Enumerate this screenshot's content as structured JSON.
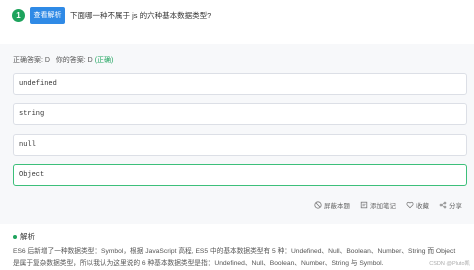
{
  "question": {
    "number": "1",
    "analysis_button": "查看解析",
    "text": "下面哪一种不属于 js 的六种基本数据类型?"
  },
  "answer": {
    "correct_label": "正确答案: D",
    "your_label": "你的答案: D",
    "status": "(正确)"
  },
  "options": [
    {
      "text": "undefined",
      "selected": false
    },
    {
      "text": "string",
      "selected": false
    },
    {
      "text": "null",
      "selected": false
    },
    {
      "text": "Object",
      "selected": true
    }
  ],
  "actions": {
    "hide": "屏蔽本题",
    "note": "添加笔记",
    "favorite": "收藏",
    "share": "分享"
  },
  "analysis": {
    "title": "解析",
    "line1": "ES6 后新增了一种数据类型：Symbol，根据 JavaScript 高程, ES5 中的基本数据类型有 5 种：Undefined、Null、Boolean、Number、String 而 Object",
    "line2": "是属于复杂数据类型，所以我认为这里说的 6 种基本数据类型是指：Undefined、Null、Boolean、Number、String 与 Symbol."
  },
  "watermark": "CSDN @Pluto凯"
}
